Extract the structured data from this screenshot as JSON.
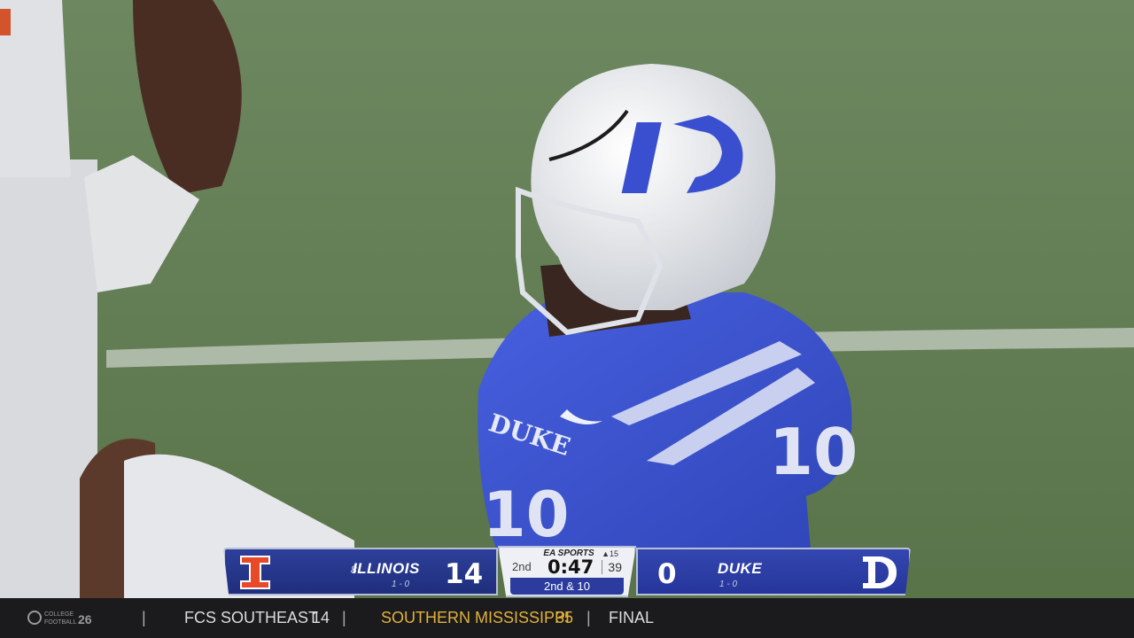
{
  "scorebug": {
    "away": {
      "rank": "8",
      "name": "ILLINOIS",
      "record": "1 - 0",
      "score": "14",
      "logo": "illinois-block-i-icon"
    },
    "home": {
      "name": "DUKE",
      "record": "1 - 0",
      "score": "0",
      "logo": "duke-d-icon"
    },
    "brand": "EA SPORTS",
    "quarter": "2nd",
    "clock": "0:47",
    "play_clock": "39",
    "timeouts_indicator": "▲15",
    "down_distance": "2nd & 10"
  },
  "ticker": {
    "logo_text": "COLLEGE FOOTBALL 26",
    "separator": "|",
    "team1": "FCS SOUTHEAST",
    "score1": "14",
    "team2": "SOUTHERN MISSISSIPPI",
    "score2": "35",
    "status": "FINAL"
  },
  "colors": {
    "duke_blue": "#2d3f9a",
    "illinois_orange": "#e84a27",
    "turf": "#5f7a52",
    "ticker_gold": "#e1b13a"
  }
}
